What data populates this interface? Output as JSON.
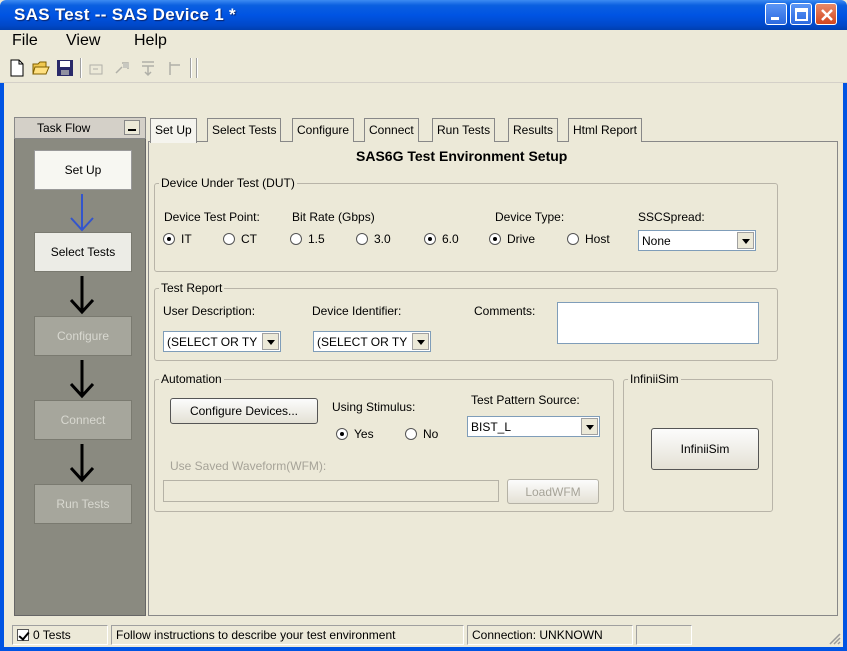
{
  "window": {
    "title": "SAS Test -- SAS Device 1 *"
  },
  "menu": [
    "File",
    "View",
    "Help"
  ],
  "toolbar_icons": [
    "new-file-icon",
    "open-folder-icon",
    "save-icon",
    "disabled-tool-1-icon",
    "disabled-tool-2-icon",
    "disabled-tool-3-icon",
    "disabled-tool-4-icon"
  ],
  "taskflow": {
    "title": "Task Flow",
    "steps": [
      {
        "label": "Set Up",
        "state": "active"
      },
      {
        "label": "Select Tests",
        "state": "done"
      },
      {
        "label": "Configure",
        "state": "disabled"
      },
      {
        "label": "Connect",
        "state": "disabled"
      },
      {
        "label": "Run Tests",
        "state": "disabled"
      }
    ]
  },
  "tabs": [
    "Set Up",
    "Select Tests",
    "Configure",
    "Connect",
    "Run Tests",
    "Results",
    "Html Report"
  ],
  "active_tab": "Set Up",
  "panel_title": "SAS6G Test Environment Setup",
  "dut": {
    "legend": "Device Under Test (DUT)",
    "test_point_label": "Device Test Point:",
    "test_point_options": [
      "IT",
      "CT"
    ],
    "test_point_selected": "IT",
    "bit_rate_label": "Bit Rate (Gbps)",
    "bit_rate_options": [
      "1.5",
      "3.0",
      "6.0"
    ],
    "bit_rate_selected": "6.0",
    "device_type_label": "Device Type:",
    "device_type_options": [
      "Drive",
      "Host"
    ],
    "device_type_selected": "Drive",
    "ssc_label": "SSCSpread:",
    "ssc_value": "None"
  },
  "report": {
    "legend": "Test Report",
    "user_desc_label": "User Description:",
    "user_desc_value": "(SELECT OR TY",
    "device_id_label": "Device Identifier:",
    "device_id_value": "(SELECT OR TY",
    "comments_label": "Comments:"
  },
  "automation": {
    "legend": "Automation",
    "configure_button": "Configure Devices...",
    "stimulus_label": "Using Stimulus:",
    "stimulus_options": [
      "Yes",
      "No"
    ],
    "stimulus_selected": "Yes",
    "pattern_label": "Test Pattern Source:",
    "pattern_value": "BIST_L",
    "saved_wfm_label": "Use Saved Waveform(WFM):",
    "load_button": "LoadWFM"
  },
  "infiniisim": {
    "legend": "InfiniiSim",
    "button": "InfiniiSim"
  },
  "status": {
    "tests": "0 Tests",
    "message": "Follow instructions to describe your test environment",
    "connection": "Connection: UNKNOWN"
  },
  "colors": {
    "title_blue": "#0054e3",
    "taskflow_bg": "#8a8a80",
    "arrow_blue": "#3355cc"
  }
}
